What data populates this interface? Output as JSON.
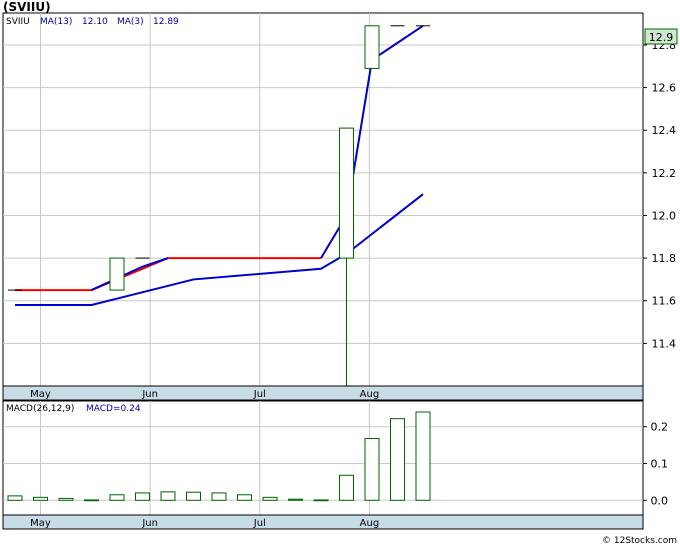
{
  "title": "(SVIIU)",
  "footer": "© 12Stocks.com",
  "colors": {
    "panel_bg": "#ffffff",
    "axis_strip": "#c8dce8",
    "grid": "#c8c8c8",
    "candle": "#006400",
    "ma13": "#0000cc",
    "ma3": "#ff0000",
    "price_tag_bg": "#cfe8cf",
    "label_blue": "#0000aa"
  },
  "chart_data": [
    {
      "type": "candlestick",
      "legend": {
        "symbol": "SVIIU",
        "ma13_label": "MA(13)",
        "ma13_value": "12.10",
        "ma3_label": "MA(3)",
        "ma3_value": "12.89"
      },
      "last_price_tag": "12.9",
      "ylim": [
        11.2,
        12.95
      ],
      "y_ticks": [
        11.4,
        11.6,
        11.8,
        12.0,
        12.2,
        12.4,
        12.6,
        12.8
      ],
      "y_tick_labels": [
        "11.4",
        "11.6",
        "11.8",
        "12.0",
        "12.2",
        "12.4",
        "12.6",
        "12.8"
      ],
      "x_tick_labels": [
        {
          "label": "May",
          "week": 1
        },
        {
          "label": "Jun",
          "week": 5.3
        },
        {
          "label": "Jul",
          "week": 9.6
        },
        {
          "label": "Aug",
          "week": 13.9
        }
      ],
      "candles": [
        {
          "week": 0,
          "open": 11.65,
          "high": 11.65,
          "low": 11.65,
          "close": 11.65
        },
        {
          "week": 4,
          "open": 11.65,
          "high": 11.8,
          "low": 11.65,
          "close": 11.8
        },
        {
          "week": 5,
          "open": 11.8,
          "high": 11.8,
          "low": 11.8,
          "close": 11.8
        },
        {
          "week": 13,
          "open": 11.8,
          "high": 12.41,
          "low": 11.2,
          "close": 12.41
        },
        {
          "week": 14,
          "open": 12.69,
          "high": 12.89,
          "low": 12.69,
          "close": 12.89
        },
        {
          "week": 15,
          "open": 12.89,
          "high": 12.89,
          "low": 12.89,
          "close": 12.89
        },
        {
          "week": 16,
          "open": 12.89,
          "high": 12.89,
          "low": 12.89,
          "close": 12.89
        }
      ],
      "series": [
        {
          "name": "MA(13)",
          "color": "#0000cc",
          "points": [
            [
              0,
              11.58
            ],
            [
              3,
              11.58
            ],
            [
              7,
              11.7
            ],
            [
              12,
              11.75
            ],
            [
              13,
              11.82
            ],
            [
              16,
              12.1
            ]
          ]
        },
        {
          "name": "MA(3)",
          "color": "#ff0000",
          "points": [
            [
              0,
              11.65
            ],
            [
              3,
              11.65
            ],
            [
              6,
              11.8
            ],
            [
              12,
              11.8
            ]
          ]
        },
        {
          "name": "MA(3)",
          "color": "#0000cc",
          "points": [
            [
              3,
              11.65
            ],
            [
              5,
              11.76
            ],
            [
              6,
              11.8
            ]
          ]
        },
        {
          "name": "MA(3)",
          "color": "#0000cc",
          "points": [
            [
              12,
              11.8
            ],
            [
              13,
              12.0
            ],
            [
              14,
              12.73
            ],
            [
              16,
              12.89
            ]
          ]
        }
      ]
    },
    {
      "type": "bar",
      "legend": {
        "label": "MACD(26,12,9)",
        "value_label": "MACD=0.24"
      },
      "ylim": [
        -0.04,
        0.27
      ],
      "y_ticks": [
        0.0,
        0.1,
        0.2
      ],
      "y_tick_labels": [
        "0.0",
        "0.1",
        "0.2"
      ],
      "x_tick_labels": [
        {
          "label": "May",
          "week": 1
        },
        {
          "label": "Jun",
          "week": 5.3
        },
        {
          "label": "Jul",
          "week": 9.6
        },
        {
          "label": "Aug",
          "week": 13.9
        }
      ],
      "bars": [
        {
          "week": 0,
          "value": 0.012
        },
        {
          "week": 1,
          "value": 0.008
        },
        {
          "week": 2,
          "value": 0.005
        },
        {
          "week": 3,
          "value": 0.001
        },
        {
          "week": 4,
          "value": 0.015
        },
        {
          "week": 5,
          "value": 0.02
        },
        {
          "week": 6,
          "value": 0.023
        },
        {
          "week": 7,
          "value": 0.022
        },
        {
          "week": 8,
          "value": 0.02
        },
        {
          "week": 9,
          "value": 0.015
        },
        {
          "week": 10,
          "value": 0.008
        },
        {
          "week": 11,
          "value": 0.003
        },
        {
          "week": 12,
          "value": 0.001
        },
        {
          "week": 13,
          "value": 0.068
        },
        {
          "week": 14,
          "value": 0.168
        },
        {
          "week": 15,
          "value": 0.222
        },
        {
          "week": 16,
          "value": 0.24
        }
      ]
    }
  ]
}
